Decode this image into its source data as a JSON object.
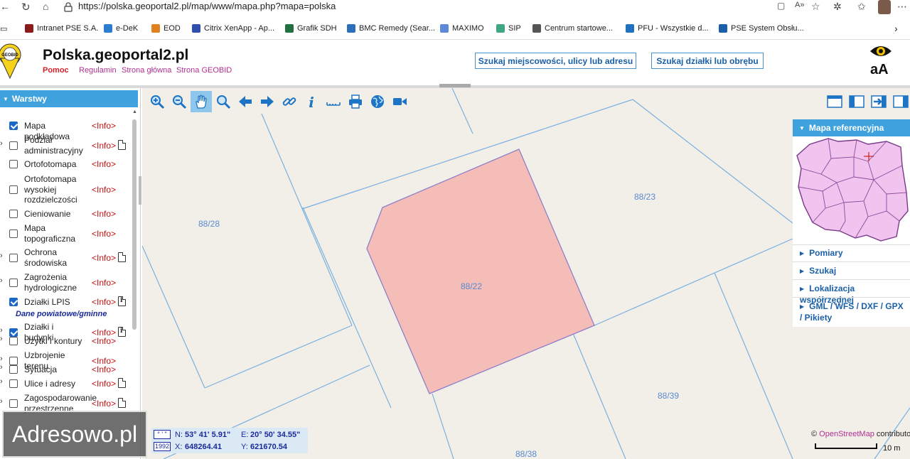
{
  "browser": {
    "url": "https://polska.geoportal2.pl/map/www/mapa.php?mapa=polska",
    "bookmarks": [
      {
        "label": "Intranet PSE S.A.",
        "color": "#8b1a1a"
      },
      {
        "label": "e-DeK",
        "color": "#2c7cd0"
      },
      {
        "label": "EOD",
        "color": "#e08020"
      },
      {
        "label": "Citrix XenApp - Ap...",
        "color": "#3050b0"
      },
      {
        "label": "Grafik SDH",
        "color": "#207040"
      },
      {
        "label": "BMC Remedy (Sear...",
        "color": "#2a6fb8"
      },
      {
        "label": "MAXIMO",
        "color": "#5a8ad8"
      },
      {
        "label": "SIP",
        "color": "#40a880"
      },
      {
        "label": "Centrum startowe...",
        "color": "#555555"
      },
      {
        "label": "PFU - Wszystkie d...",
        "color": "#2070c0"
      },
      {
        "label": "PSE System Obsłu...",
        "color": "#1a5fa8"
      }
    ]
  },
  "header": {
    "title": "Polska.geoportal2.pl",
    "logo_text": "GEOBID",
    "links": [
      "Pomoc",
      "Regulamin",
      "Strona główna",
      "Strona GEOBID"
    ],
    "search_location_button": "Szukaj miejscowości, ulicy lub adresu",
    "search_parcel_button": "Szukaj działki lub obrębu",
    "font_size_label": "aA"
  },
  "layers_panel": {
    "title": "Warstwy",
    "group_label": "Dane powiatowe/gminne",
    "items": [
      {
        "label": "Mapa podkładowa",
        "checked": true,
        "expandable": false,
        "info": "<Info>",
        "doc": ""
      },
      {
        "label": "Podział administracyjny",
        "checked": false,
        "expandable": true,
        "info": "<Info>",
        "doc": "doc"
      },
      {
        "label": "Ortofotomapa",
        "checked": false,
        "expandable": false,
        "info": "<Info>",
        "doc": ""
      },
      {
        "label": "Ortofotomapa wysokiej rozdzielczości",
        "checked": false,
        "expandable": false,
        "info": "<Info>",
        "doc": ""
      },
      {
        "label": "Cieniowanie",
        "checked": false,
        "expandable": false,
        "info": "<Info>",
        "doc": ""
      },
      {
        "label": "Mapa topograficzna",
        "checked": false,
        "expandable": false,
        "info": "<Info>",
        "doc": ""
      },
      {
        "label": "Ochrona środowiska",
        "checked": false,
        "expandable": true,
        "info": "<Info>",
        "doc": "doc"
      },
      {
        "label": "Zagrożenia hydrologiczne",
        "checked": false,
        "expandable": true,
        "info": "<Info>",
        "doc": ""
      },
      {
        "label": "Działki LPIS",
        "checked": true,
        "expandable": false,
        "info": "<Info>",
        "doc": "info-doc"
      },
      {
        "label": "Działki i budynki",
        "checked": true,
        "expandable": true,
        "info": "<Info>",
        "doc": "info-doc"
      },
      {
        "label": "Użytki i kontury",
        "checked": false,
        "expandable": true,
        "info": "<Info>",
        "doc": ""
      },
      {
        "label": "Uzbrojenie terenu",
        "checked": false,
        "expandable": true,
        "info": "<Info>",
        "doc": ""
      },
      {
        "label": "Sytuacja",
        "checked": false,
        "expandable": true,
        "info": "<Info>",
        "doc": ""
      },
      {
        "label": "Ulice i adresy",
        "checked": false,
        "expandable": true,
        "info": "<Info>",
        "doc": "doc"
      },
      {
        "label": "Zagospodarowanie przestrzenne",
        "checked": false,
        "expandable": true,
        "info": "<Info>",
        "doc": "doc"
      }
    ]
  },
  "map": {
    "parcels": [
      "88/28",
      "88/23",
      "88/22",
      "88/39",
      "88/38"
    ],
    "highlight_fill": "#f4bdb8",
    "line_color": "#7ab0e0"
  },
  "reference_panel": {
    "title": "Mapa referencyjna",
    "links": [
      "Pomiary",
      "Szukaj",
      "Lokalizacja współrzędnej",
      "GML / WFS / DXF / GPX / Pikiety"
    ]
  },
  "coordinates": {
    "mode_deg": "° ' \"",
    "mode_1992": "1992",
    "n_label": "N:",
    "n_value": "53° 41' 5.91\"",
    "e_label": "E:",
    "e_value": "20° 50' 34.55\"",
    "x_label": "X:",
    "x_value": "648264.41",
    "y_label": "Y:",
    "y_value": "621670.54"
  },
  "attribution": {
    "prefix": "©",
    "link": "OpenStreetMap",
    "suffix": "contributors"
  },
  "scale": "10 m",
  "watermark": "Adresowo.pl"
}
